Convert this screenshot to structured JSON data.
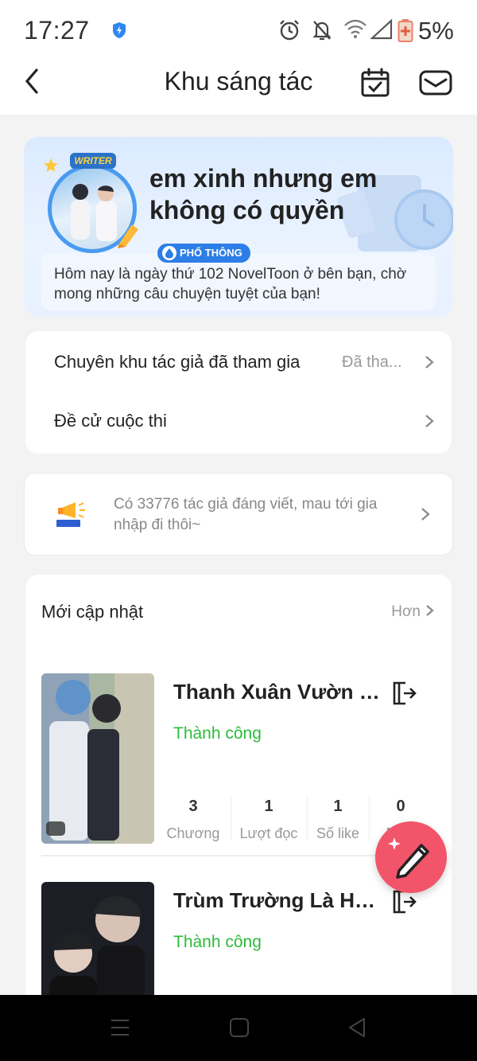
{
  "status_bar": {
    "time": "17:27",
    "battery": "5%",
    "icons": [
      "shield-icon",
      "alarm-icon",
      "bell-off-icon",
      "wifi-icon",
      "signal-icon",
      "battery-icon"
    ]
  },
  "header": {
    "title": "Khu sáng tác",
    "back_icon": "back-arrow-icon",
    "calendar_icon": "calendar-check-icon",
    "mail_icon": "mail-icon"
  },
  "profile": {
    "badge": "WRITER",
    "username": "em xinh nhưng em không có quyền",
    "tier": "PHỔ THÔNG",
    "message": "Hôm nay là ngày thứ 102 NovelToon ở bên bạn, chờ mong những câu chuyện tuyệt của bạn!"
  },
  "menu": {
    "items": [
      {
        "label": "Chuyên khu tác giả đã tham gia",
        "value": "Đã tha..."
      },
      {
        "label": "Đề cử cuộc thi",
        "value": ""
      }
    ]
  },
  "notice": {
    "icon": "megaphone-icon",
    "text": "Có 33776 tác giả đáng viết, mau tới gia nhập đi thôi~"
  },
  "updates": {
    "title": "Mới cập nhật",
    "more": "Hơn",
    "books": [
      {
        "title": "Thanh Xuân Vườn Tr...",
        "status": "Thành công",
        "stats": [
          {
            "num": "3",
            "label": "Chương"
          },
          {
            "num": "1",
            "label": "Lượt đọc"
          },
          {
            "num": "1",
            "label": "Số like"
          },
          {
            "num": "0",
            "label": "Bình"
          }
        ]
      },
      {
        "title": "Trùm Trường Là Hôn...",
        "status": "Thành công"
      }
    ]
  },
  "fab": {
    "icon": "pencil-icon"
  },
  "nav": {
    "icons": [
      "menu-nav-icon",
      "home-nav-icon",
      "back-nav-icon"
    ]
  }
}
